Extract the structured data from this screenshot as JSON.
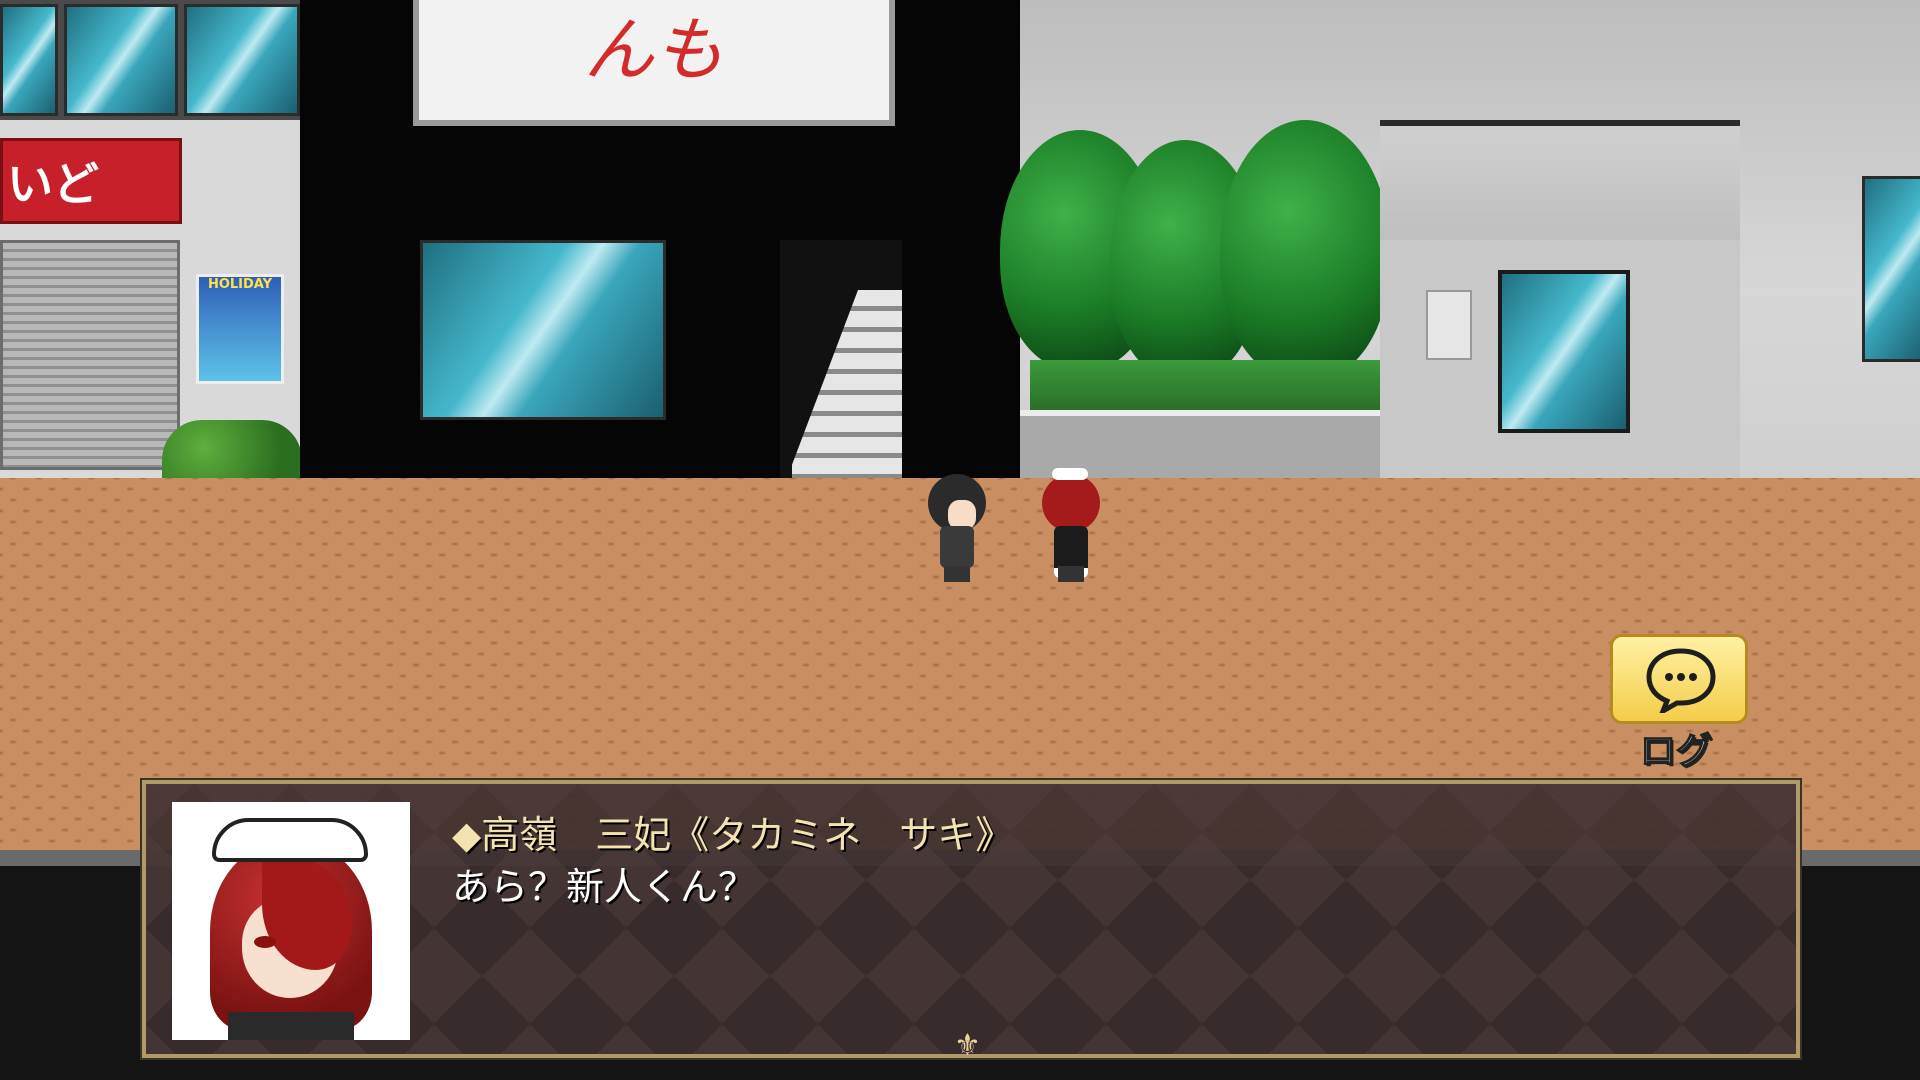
{
  "scene": {
    "left_sign_text": "いど屋！",
    "top_sign_text": "んも",
    "poster_text": "HOLIDAY"
  },
  "colors": {
    "window_border": "#b09a6a",
    "speaker_name": "#f2e3b0",
    "log_button": "#f4cd4a"
  },
  "log_button": {
    "icon": "speech-bubble-icon",
    "label": "ログ"
  },
  "message_window": {
    "portrait": "maid-portrait",
    "speaker": "◆高嶺　三妃《タカミネ　サキ》",
    "text": "あら？新人くん？",
    "advance_icon": "fleur-de-lis-icon",
    "advance_glyph": "⚜"
  }
}
